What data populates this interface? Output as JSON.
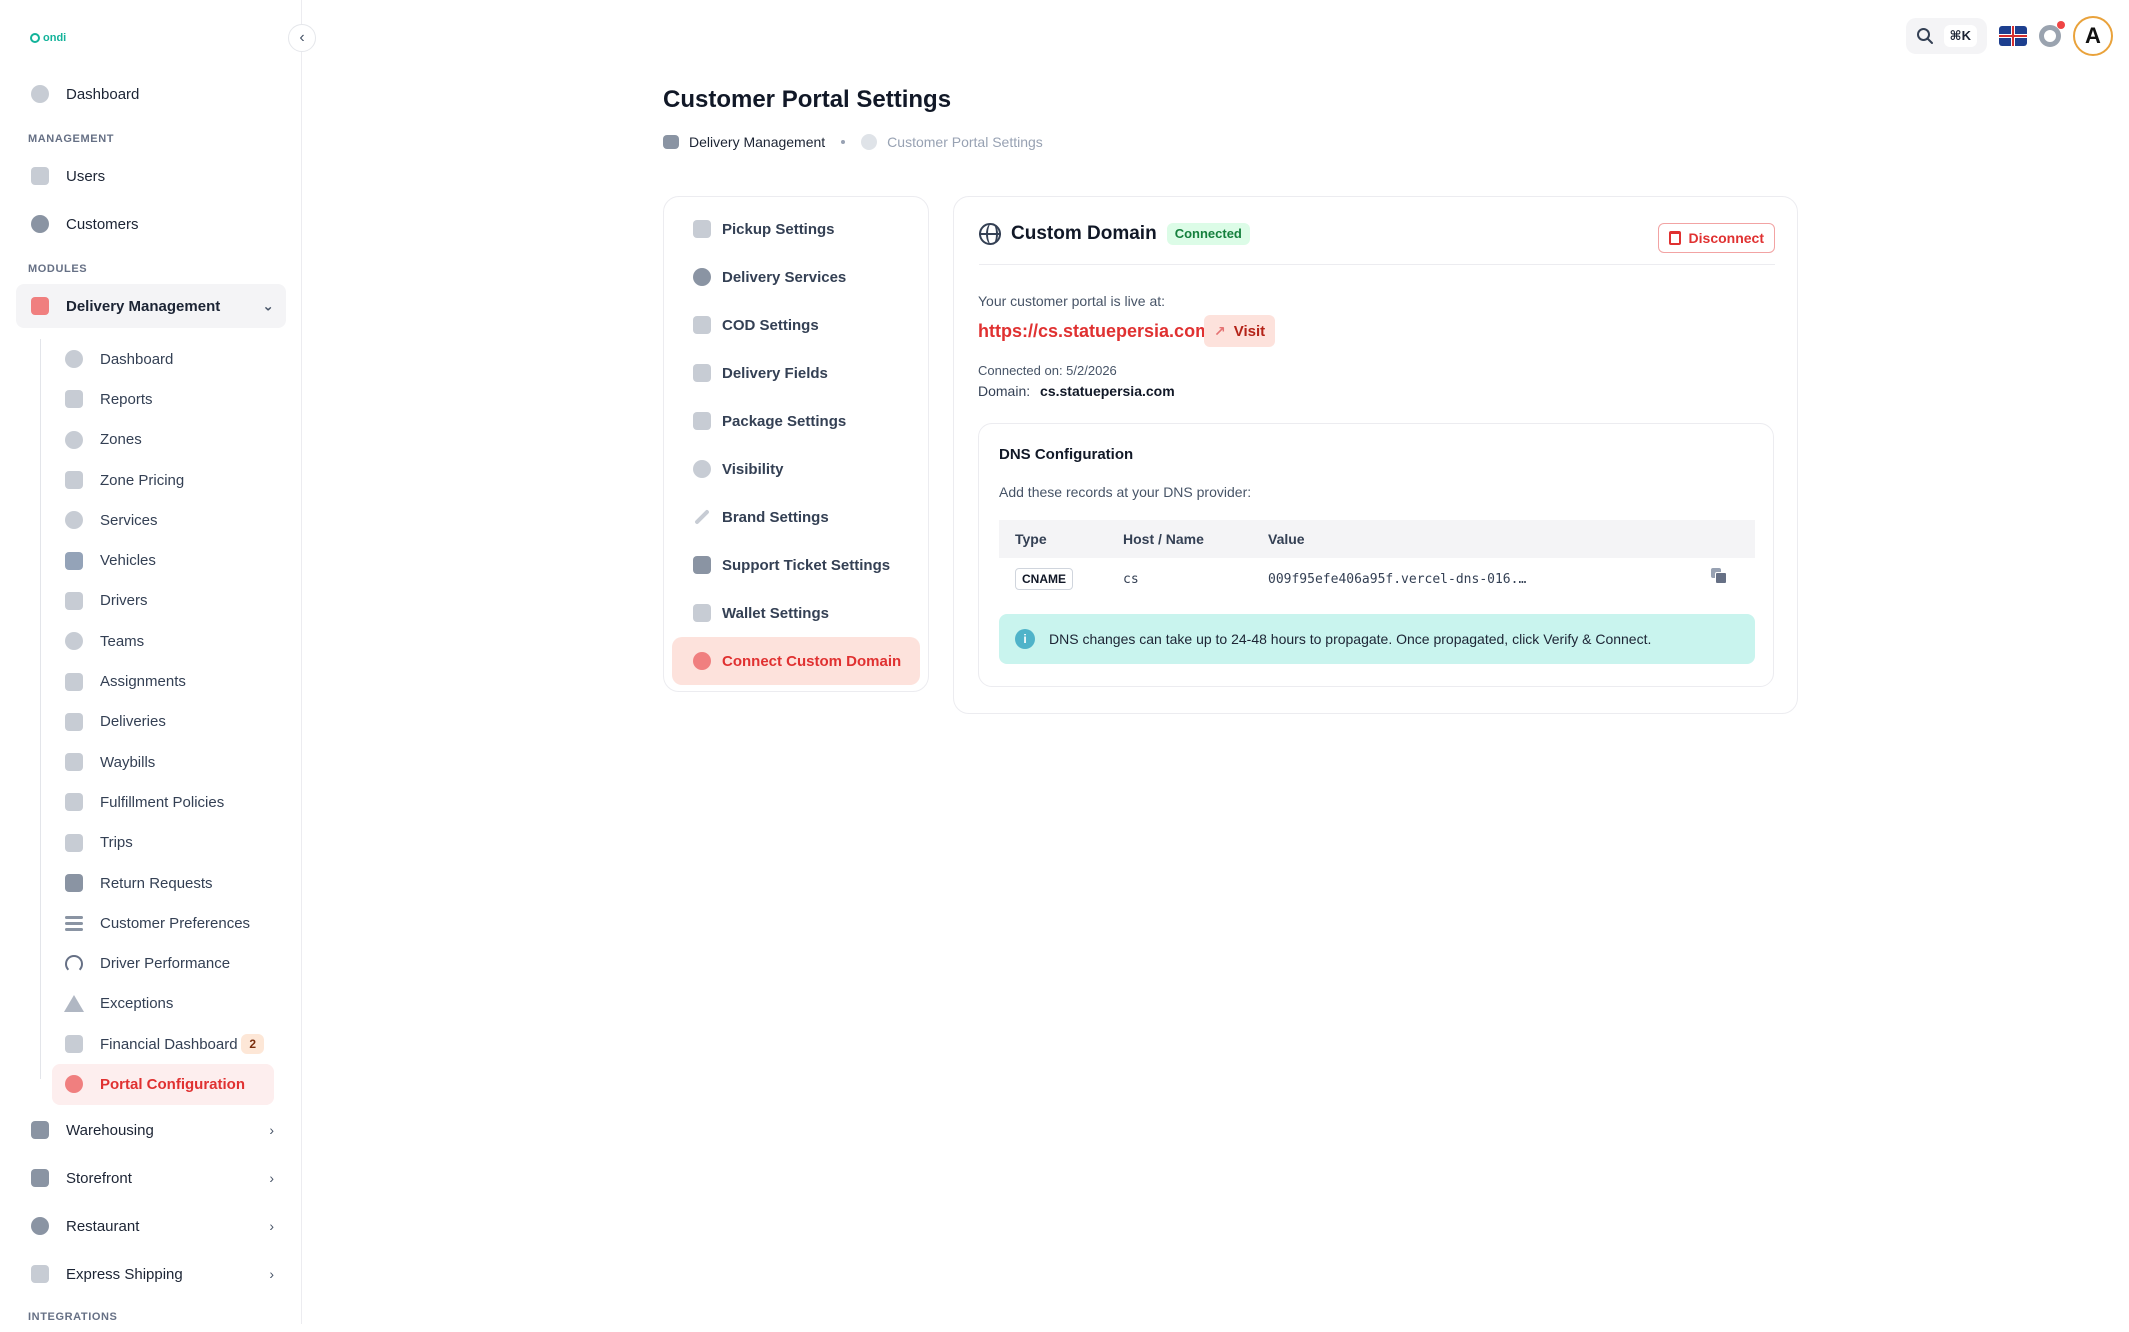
{
  "brand": {
    "logo_text": "ondi",
    "accent": "#13b39a",
    "danger": "#e03131"
  },
  "sidebar": {
    "top_items": [
      {
        "label": "Dashboard",
        "icon": "dashboard-icon"
      }
    ],
    "sections": {
      "management": "MANAGEMENT",
      "modules": "MODULES",
      "integrations": "INTEGRATIONS"
    },
    "management_items": [
      {
        "label": "Users",
        "icon": "user-icon"
      },
      {
        "label": "Customers",
        "icon": "customers-icon"
      }
    ],
    "module_parent": {
      "label": "Delivery Management",
      "icon": "delivery-truck-icon",
      "expanded": true
    },
    "sub_items": [
      {
        "label": "Dashboard",
        "icon": "dashboard-icon"
      },
      {
        "label": "Reports",
        "icon": "reports-icon"
      },
      {
        "label": "Zones",
        "icon": "zones-icon"
      },
      {
        "label": "Zone Pricing",
        "icon": "pricing-icon"
      },
      {
        "label": "Services",
        "icon": "services-icon"
      },
      {
        "label": "Vehicles",
        "icon": "vehicles-icon"
      },
      {
        "label": "Drivers",
        "icon": "drivers-icon"
      },
      {
        "label": "Teams",
        "icon": "teams-icon"
      },
      {
        "label": "Assignments",
        "icon": "assignments-icon"
      },
      {
        "label": "Deliveries",
        "icon": "deliveries-icon"
      },
      {
        "label": "Waybills",
        "icon": "waybills-icon"
      },
      {
        "label": "Fulfillment Policies",
        "icon": "policies-icon"
      },
      {
        "label": "Trips",
        "icon": "trips-icon"
      },
      {
        "label": "Return Requests",
        "icon": "return-icon"
      },
      {
        "label": "Customer Preferences",
        "icon": "sliders-icon"
      },
      {
        "label": "Driver Performance",
        "icon": "gauge-icon"
      },
      {
        "label": "Exceptions",
        "icon": "warning-icon"
      },
      {
        "label": "Financial Dashboard",
        "icon": "finance-icon",
        "badge": "2"
      },
      {
        "label": "Portal Configuration",
        "icon": "wrench-icon",
        "active": true
      }
    ],
    "bottom_items": [
      {
        "label": "Warehousing",
        "icon": "warehouse-icon"
      },
      {
        "label": "Storefront",
        "icon": "storefront-icon"
      },
      {
        "label": "Restaurant",
        "icon": "restaurant-icon"
      },
      {
        "label": "Express Shipping",
        "icon": "shipping-icon"
      }
    ]
  },
  "topbar": {
    "shortcut": "⌘K",
    "language": "English (UK)",
    "avatar_initial": "A"
  },
  "page": {
    "title": "Customer Portal Settings",
    "breadcrumb": [
      "Delivery Management",
      "Customer Portal Settings"
    ]
  },
  "settings_nav": [
    {
      "label": "Pickup Settings",
      "icon": "pickup-icon"
    },
    {
      "label": "Delivery Services",
      "icon": "delivery-services-icon"
    },
    {
      "label": "COD Settings",
      "icon": "cod-icon"
    },
    {
      "label": "Delivery Fields",
      "icon": "fields-icon"
    },
    {
      "label": "Package Settings",
      "icon": "package-icon"
    },
    {
      "label": "Visibility",
      "icon": "eye-icon"
    },
    {
      "label": "Brand Settings",
      "icon": "brush-icon"
    },
    {
      "label": "Support Ticket Settings",
      "icon": "ticket-icon"
    },
    {
      "label": "Wallet Settings",
      "icon": "wallet-icon"
    },
    {
      "label": "Connect Custom Domain",
      "icon": "globe-icon",
      "active": true
    }
  ],
  "custom_domain": {
    "title": "Custom Domain",
    "status": "Connected",
    "disconnect_label": "Disconnect",
    "live_label": "Your customer portal is live at:",
    "url": "https://cs.statuepersia.com",
    "visit_label": "Visit",
    "connected_on": "Connected on: 5/2/2026",
    "domain_label": "Domain:",
    "domain_value": "cs.statuepersia.com",
    "dns": {
      "title": "DNS Configuration",
      "subtitle": "Add these records at your DNS provider:",
      "columns": [
        "Type",
        "Host / Name",
        "Value"
      ],
      "rows": [
        {
          "type": "CNAME",
          "host": "cs",
          "value": "009f95efe406a95f.vercel-dns-016.…"
        }
      ],
      "info": "DNS changes can take up to 24-48 hours to propagate. Once propagated, click Verify & Connect."
    }
  }
}
